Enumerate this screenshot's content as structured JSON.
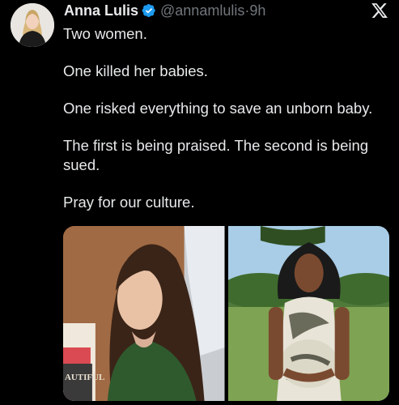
{
  "tweet": {
    "author_name": "Anna Lulis",
    "handle": "@annamlulis",
    "separator": "·",
    "time": "9h",
    "paragraphs": [
      "Two women.",
      "One killed her babies.",
      "One risked everything to save an unborn baby.",
      "The first is being praised. The second is being sued.",
      "Pray for our culture."
    ],
    "media": [
      {
        "icon": "photo-woman-courtroom"
      },
      {
        "icon": "photo-pregnant-woman-field"
      }
    ],
    "photo_text": "AUTIFUL"
  },
  "colors": {
    "background": "#000000",
    "text": "#e7e9ea",
    "secondary": "#71767b",
    "verified": "#1d9bf0"
  },
  "icons": {
    "verified": "verified-badge-icon",
    "platform": "x-logo-icon"
  }
}
